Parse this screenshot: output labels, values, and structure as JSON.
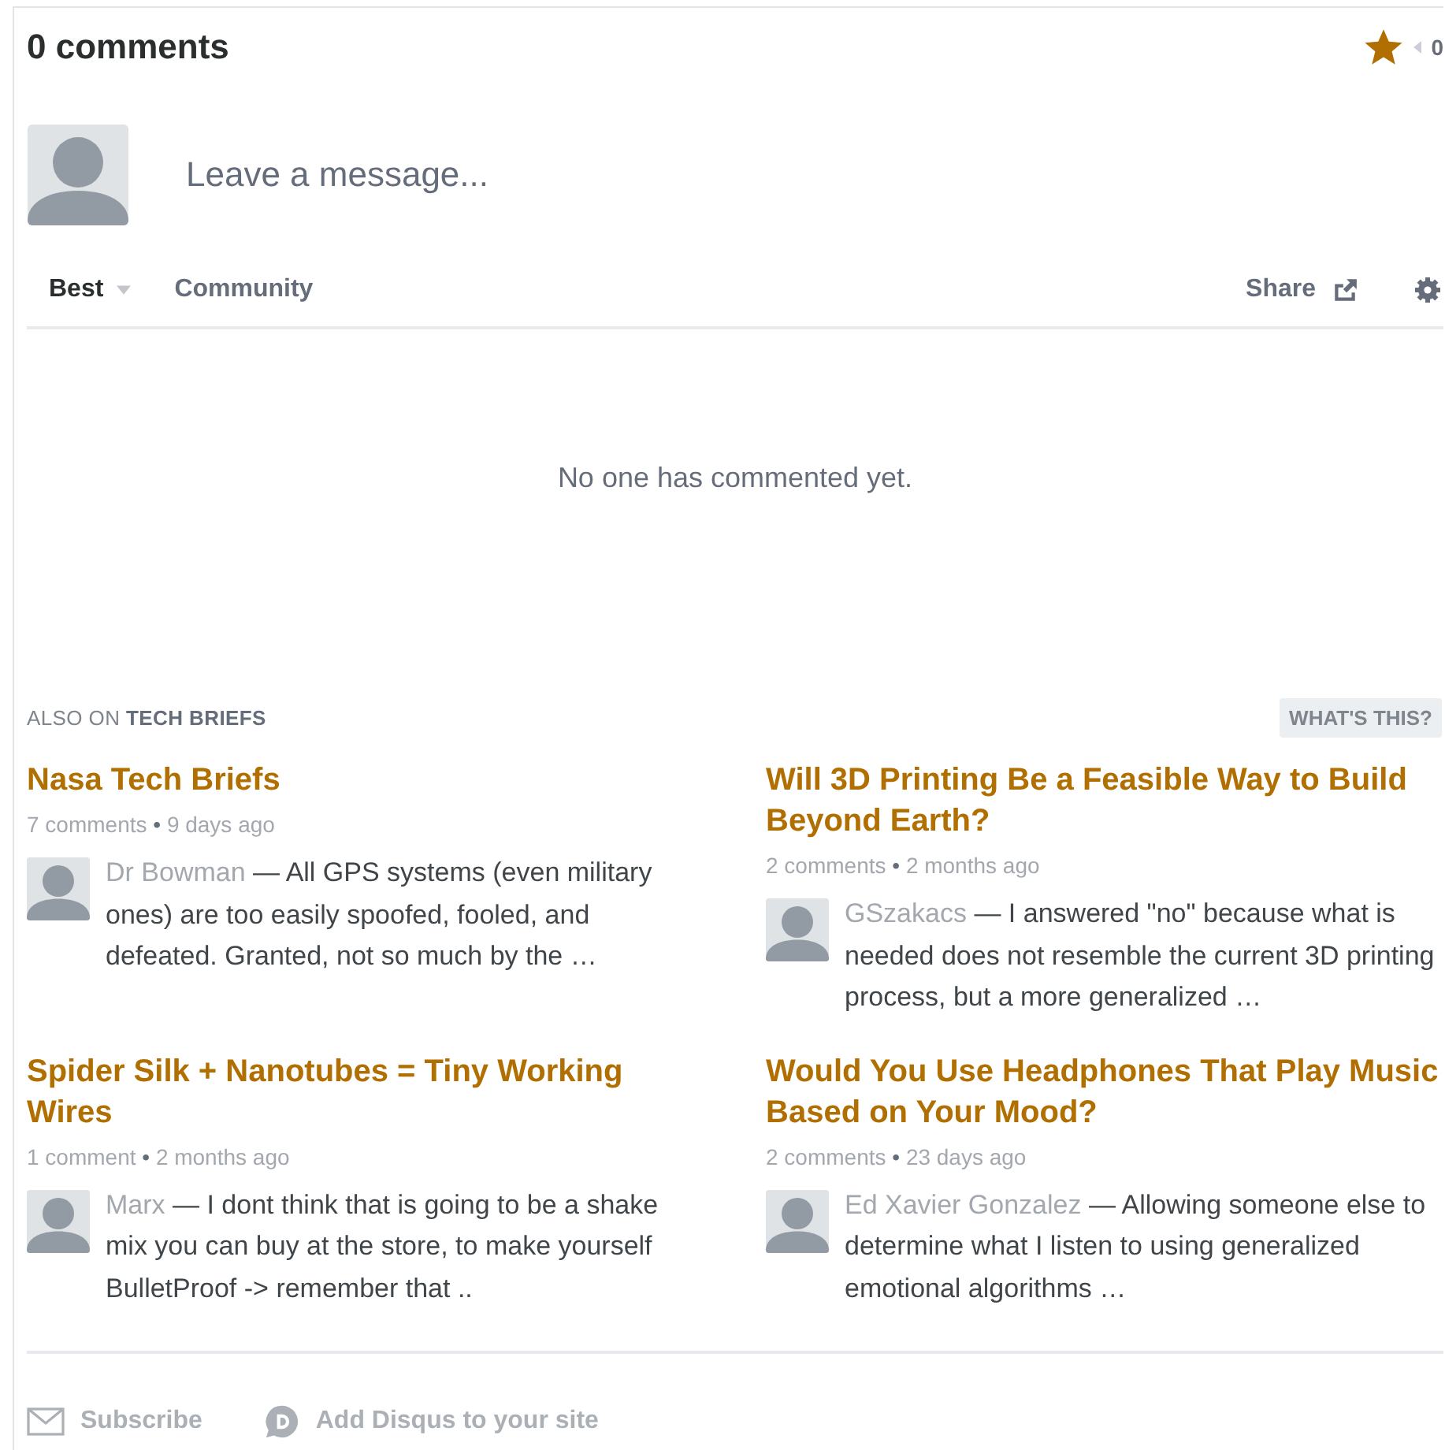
{
  "header": {
    "title": "0 comments",
    "favorited": true,
    "count": "0"
  },
  "composer": {
    "placeholder": "Leave a message..."
  },
  "tabs": [
    {
      "label": "Best",
      "selected": true,
      "dropdown": true
    },
    {
      "label": "Community",
      "selected": false,
      "dropdown": false
    }
  ],
  "share": {
    "label": "Share"
  },
  "separator": "•",
  "empty_message": "No one has commented yet.",
  "also_on": {
    "prefix": "ALSO ON",
    "site": "TECH BRIEFS",
    "help": "WHAT'S THIS?"
  },
  "discussions": [
    {
      "title": "Nasa Tech Briefs",
      "comments": "7 comments",
      "age": "9 days ago",
      "author": "Dr Bowman",
      "excerpt": "— All GPS systems (even military ones) are too easily spoofed, fooled, and defeated. Granted, not so much by the …"
    },
    {
      "title": "Will 3D Printing Be a Feasible Way to Build Beyond Earth?",
      "comments": "2 comments",
      "age": "2 months ago",
      "author": "GSzakacs",
      "excerpt": "— I answered \"no\" because what is needed does not resemble the current 3D printing process, but a more generalized …"
    },
    {
      "title": "Spider Silk + Nanotubes = Tiny Working Wires",
      "comments": "1 comment",
      "age": "2 months ago",
      "author": "Marx",
      "excerpt": "— I dont think that is going to be a shake mix you can buy at the store, to make yourself BulletProof -> remember that .."
    },
    {
      "title": "Would You Use Headphones That Play Music Based on Your Mood?",
      "comments": "2 comments",
      "age": "23 days ago",
      "author": "Ed Xavier Gonzalez",
      "excerpt": "— Allowing someone else to determine what I listen to using generalized emotional algorithms …"
    }
  ],
  "footer": [
    {
      "kind": "subscribe",
      "label": "Subscribe"
    },
    {
      "kind": "disqus",
      "label": "Add Disqus to your site"
    }
  ]
}
